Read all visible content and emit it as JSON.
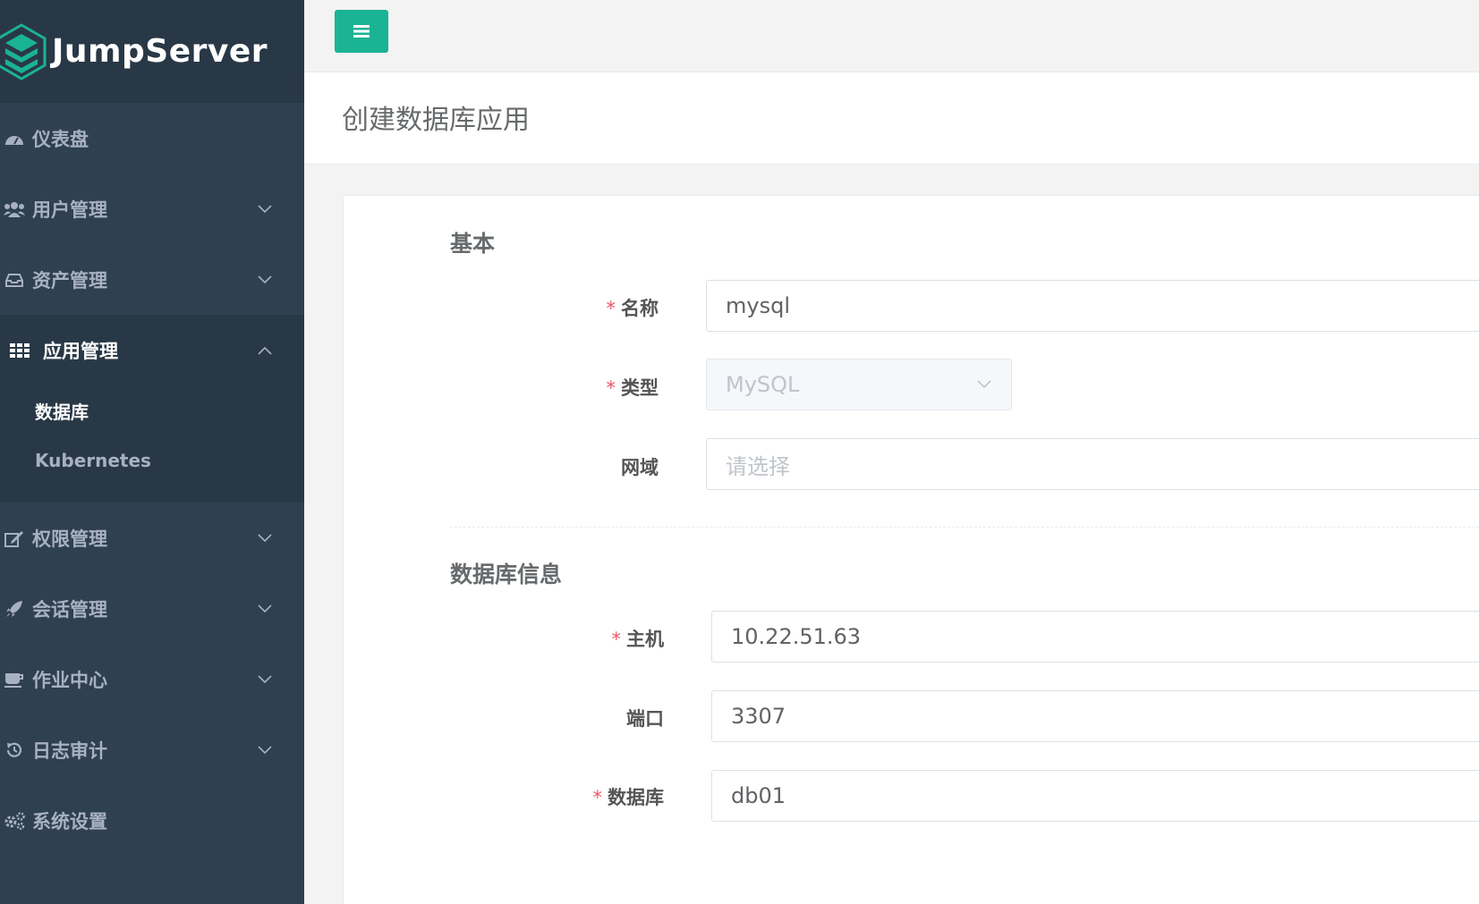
{
  "app": {
    "logo_text": "JumpServer"
  },
  "sidebar": {
    "items": [
      {
        "label": "仪表盘",
        "icon": "dashboard-icon"
      },
      {
        "label": "用户管理",
        "icon": "users-icon"
      },
      {
        "label": "资产管理",
        "icon": "inbox-icon"
      },
      {
        "label": "应用管理",
        "icon": "grid-icon",
        "expanded": true,
        "children": [
          {
            "label": "数据库",
            "current": true
          },
          {
            "label": "Kubernetes"
          }
        ]
      },
      {
        "label": "权限管理",
        "icon": "edit-icon"
      },
      {
        "label": "会话管理",
        "icon": "rocket-icon"
      },
      {
        "label": "作业中心",
        "icon": "coffee-icon"
      },
      {
        "label": "日志审计",
        "icon": "history-icon"
      },
      {
        "label": "系统设置",
        "icon": "gears-icon"
      }
    ]
  },
  "page": {
    "title": "创建数据库应用"
  },
  "form": {
    "basic": {
      "title": "基本",
      "name": {
        "label": "名称",
        "required": true,
        "value": "mysql"
      },
      "type": {
        "label": "类型",
        "required": true,
        "value": "MySQL",
        "disabled": true
      },
      "domain": {
        "label": "网域",
        "required": false,
        "placeholder": "请选择"
      }
    },
    "db_info": {
      "title": "数据库信息",
      "host": {
        "label": "主机",
        "required": true,
        "value": "10.22.51.63"
      },
      "port": {
        "label": "端口",
        "required": false,
        "value": "3307"
      },
      "database": {
        "label": "数据库",
        "required": true,
        "value": "db01"
      }
    },
    "required_mark": "*"
  },
  "colors": {
    "sidebar_bg": "#2f4050",
    "sidebar_active_bg": "#293846",
    "accent": "#1ab394",
    "required": "#ed5565"
  }
}
